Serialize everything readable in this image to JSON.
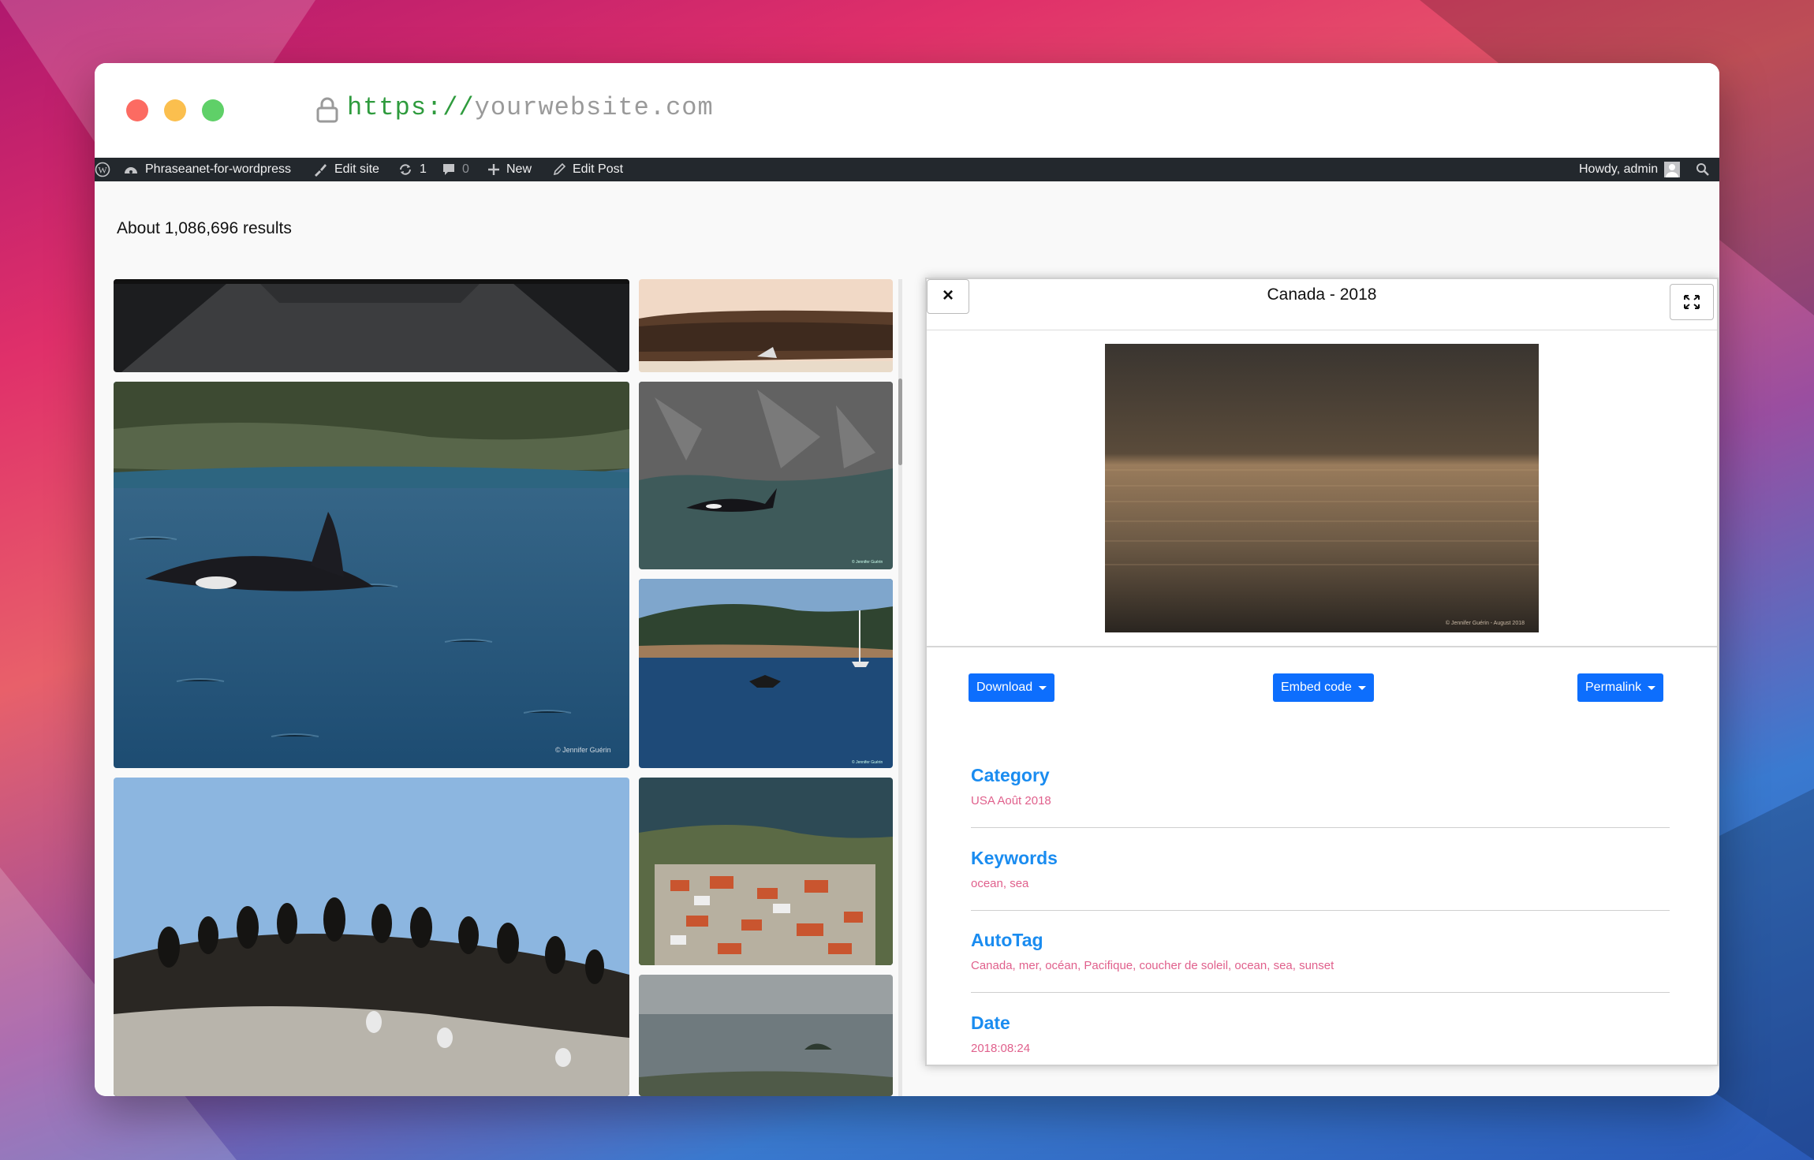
{
  "browser": {
    "url_scheme": "https://",
    "url_host": "yourwebsite.com"
  },
  "admin_bar": {
    "site_name": "Phraseanet-for-wordpress",
    "edit_site": "Edit site",
    "updates_count": "1",
    "comments_count": "0",
    "new_label": "New",
    "edit_post": "Edit Post",
    "howdy": "Howdy, admin"
  },
  "results": {
    "summary": "About 1,086,696 results"
  },
  "detail_panel": {
    "close_label": "×",
    "title": "Canada - 2018",
    "preview_credit": "© Jennifer Guérin - August 2018",
    "buttons": {
      "download": "Download",
      "embed": "Embed code",
      "permalink": "Permalink"
    },
    "metadata": [
      {
        "label": "Category",
        "value": "USA Août 2018"
      },
      {
        "label": "Keywords",
        "value": "ocean, sea"
      },
      {
        "label": "AutoTag",
        "value": "Canada, mer, océan, Pacifique, coucher de soleil, ocean, sea, sunset"
      },
      {
        "label": "Date",
        "value": "2018:08:24"
      }
    ]
  },
  "gallery": {
    "tiles": [
      "road-photo",
      "cliff-beach-photo",
      "orca-large-photo",
      "orca-cliff-photo",
      "whale-tail-photo",
      "birds-rock-photo",
      "coastal-town-photo",
      "sea-island-photo"
    ]
  },
  "colors": {
    "admin_bar_bg": "#23282d",
    "primary_button": "#0d6efd",
    "meta_label": "#1a8cf0",
    "meta_value": "#e0608c",
    "url_scheme": "#2e9b3d"
  }
}
